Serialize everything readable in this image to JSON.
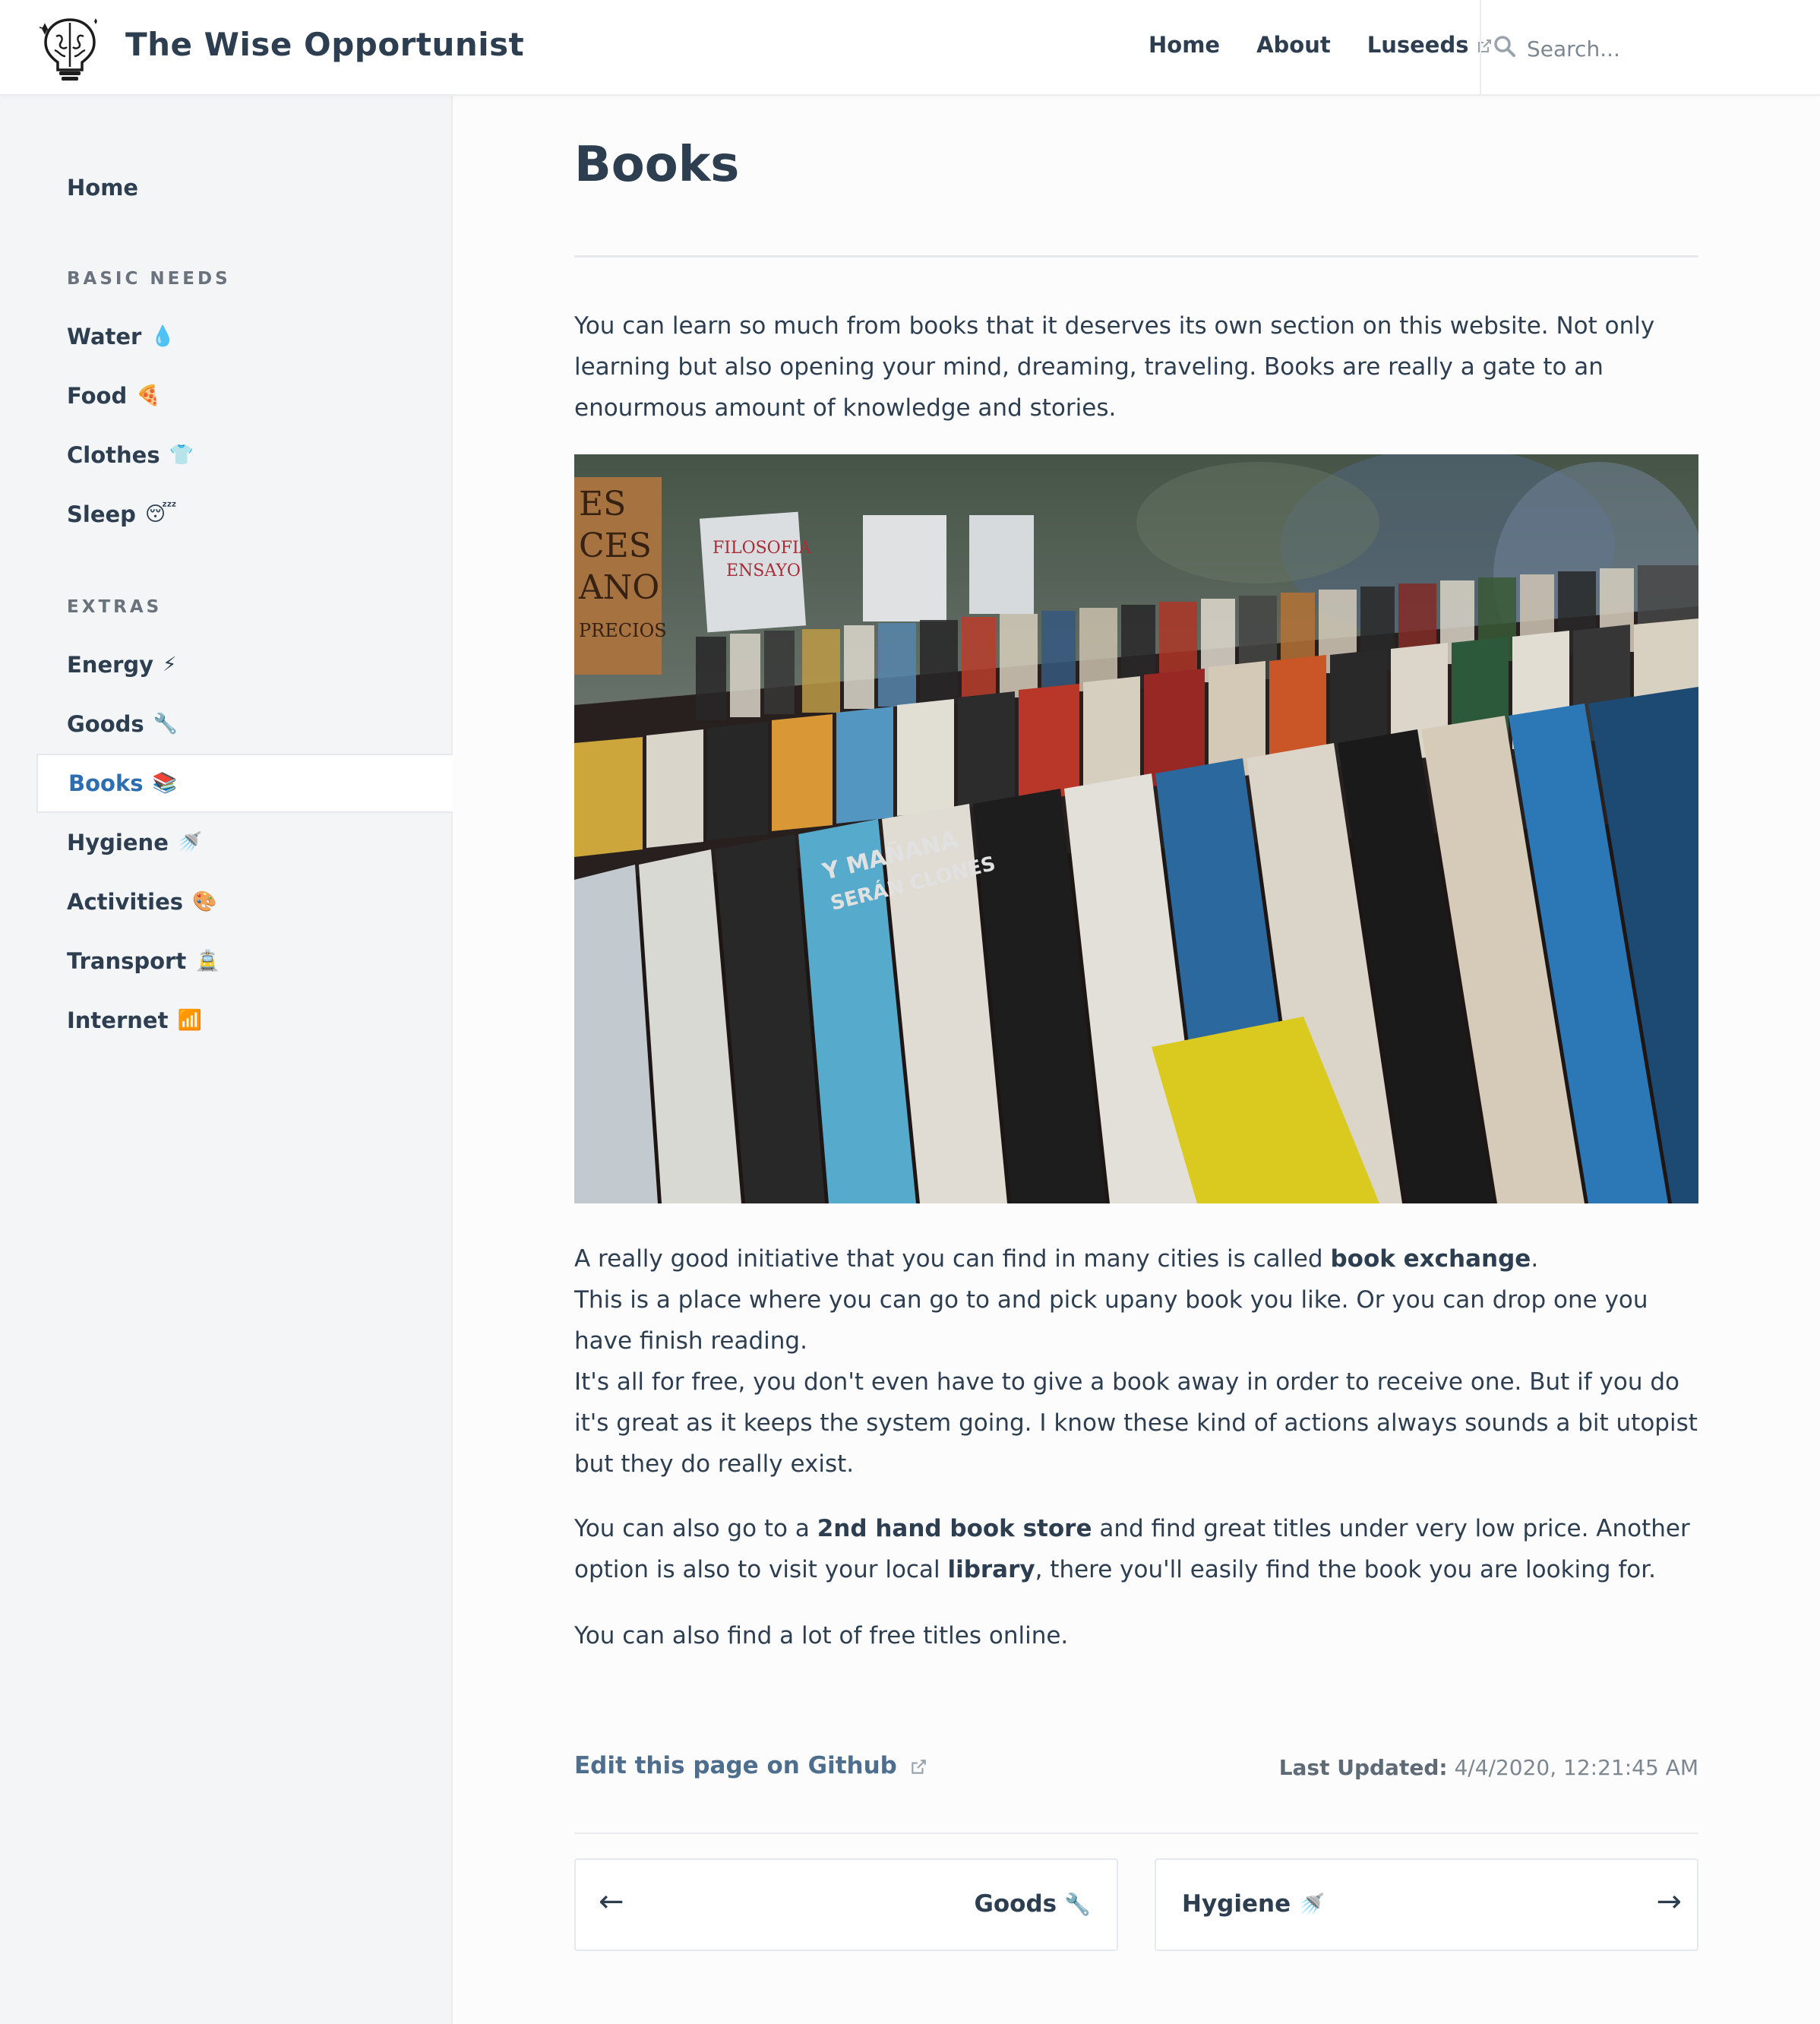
{
  "header": {
    "site_title": "The Wise Opportunist",
    "nav": [
      {
        "label": "Home"
      },
      {
        "label": "About"
      },
      {
        "label": "Luseeds",
        "external": true
      }
    ],
    "search_placeholder": "Search..."
  },
  "sidebar": {
    "home": "Home",
    "sections": [
      {
        "title": "BASIC NEEDS",
        "items": [
          {
            "label": "Water",
            "emoji": "💧"
          },
          {
            "label": "Food",
            "emoji": "🍕"
          },
          {
            "label": "Clothes",
            "emoji": "👕"
          },
          {
            "label": "Sleep",
            "emoji": "😴"
          }
        ]
      },
      {
        "title": "EXTRAS",
        "items": [
          {
            "label": "Energy",
            "emoji": "⚡"
          },
          {
            "label": "Goods",
            "emoji": "🔧"
          },
          {
            "label": "Books",
            "emoji": "📚",
            "active": true
          },
          {
            "label": "Hygiene",
            "emoji": "🚿"
          },
          {
            "label": "Activities",
            "emoji": "🎨"
          },
          {
            "label": "Transport",
            "emoji": "🚊"
          },
          {
            "label": "Internet",
            "emoji": "📶"
          }
        ]
      }
    ]
  },
  "content": {
    "title": "Books",
    "intro": "You can learn so much from books that it deserves its own section on this website. Not only learning but also opening your mind, dreaming, traveling. Books are really a gate to an enourmous amount of knowledge and stories.",
    "image_alt": "Rows of second-hand books at an outdoor book market",
    "p2_line1_before": "A really good initiative that you can find in many cities is called ",
    "p2_line1_bold": "book exchange",
    "p2_line1_after": ".",
    "p2_line2": "This is a place where you can go to and pick upany book you like. Or you can drop one you have finish reading.",
    "p2_line3": "It's all for free, you don't even have to give a book away in order to receive one. But if you do it's great as it keeps the system going. I know these kind of actions always sounds a bit utopist but they do really exist.",
    "p3_before": "You can also go to a ",
    "p3_bold1": "2nd hand book store",
    "p3_mid": " and find great titles under very low price. Another option is also to visit your local ",
    "p3_bold2": "library",
    "p3_after": ", there you'll easily find the book you are looking for.",
    "p4": "You can also find a lot of free titles online."
  },
  "footer": {
    "edit_link": "Edit this page on Github",
    "last_updated_label": "Last Updated:",
    "last_updated_value": "4/4/2020, 12:21:45 AM",
    "prev": {
      "arrow": "←",
      "label": "Goods",
      "emoji": "🔧"
    },
    "next": {
      "arrow": "→",
      "label": "Hygiene",
      "emoji": "🚿"
    }
  },
  "colors": {
    "accent": "#2c6eb0",
    "text": "#2c3e50",
    "sidebar_bg": "#f4f5f7",
    "muted": "#7d8791"
  }
}
